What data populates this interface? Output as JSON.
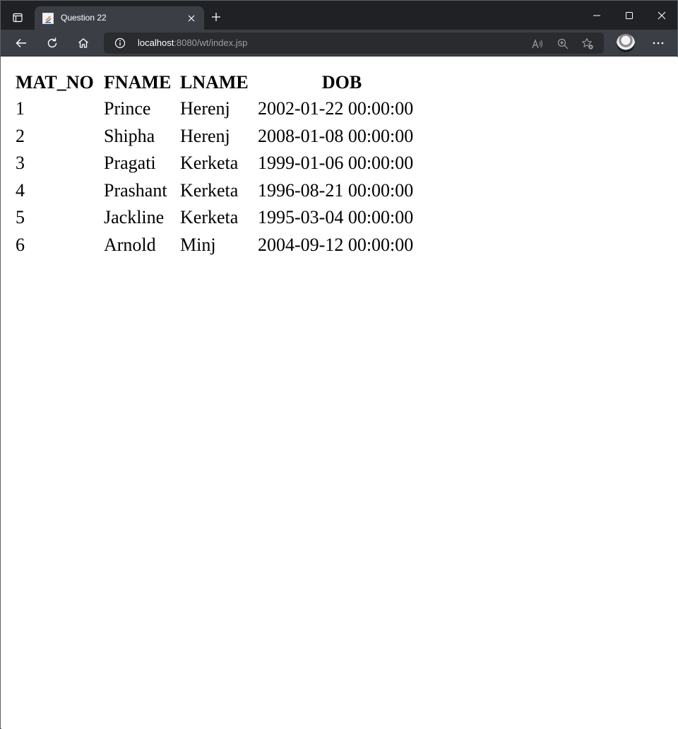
{
  "browser": {
    "tab": {
      "title": "Question 22",
      "favicon": "java-icon"
    },
    "address": {
      "host": "localhost",
      "rest": ":8080/wt/index.jsp"
    },
    "icons": {
      "tab_actions": "tab-actions-icon",
      "close_tab": "close-icon",
      "new_tab": "plus-icon",
      "minimize": "minimize-icon",
      "maximize": "maximize-icon",
      "close_window": "close-icon",
      "back": "back-arrow-icon",
      "refresh": "refresh-icon",
      "home": "home-icon",
      "site_info": "info-icon",
      "read_aloud": "read-aloud-icon",
      "zoom": "zoom-icon",
      "favorites": "favorites-star-icon",
      "menu": "more-icon"
    },
    "colors": {
      "frame": "#202124",
      "toolbar": "#3b3f45",
      "omnibox": "#292b2f"
    }
  },
  "table": {
    "headers": [
      "MAT_NO",
      "FNAME",
      "LNAME",
      "DOB"
    ],
    "rows": [
      [
        "1",
        "Prince",
        "Herenj",
        "2002-01-22 00:00:00"
      ],
      [
        "2",
        "Shipha",
        "Herenj",
        "2008-01-08 00:00:00"
      ],
      [
        "3",
        "Pragati",
        "Kerketa",
        "1999-01-06 00:00:00"
      ],
      [
        "4",
        "Prashant",
        "Kerketa",
        "1996-08-21 00:00:00"
      ],
      [
        "5",
        "Jackline",
        "Kerketa",
        "1995-03-04 00:00:00"
      ],
      [
        "6",
        "Arnold",
        "Minj",
        "2004-09-12 00:00:00"
      ]
    ]
  }
}
